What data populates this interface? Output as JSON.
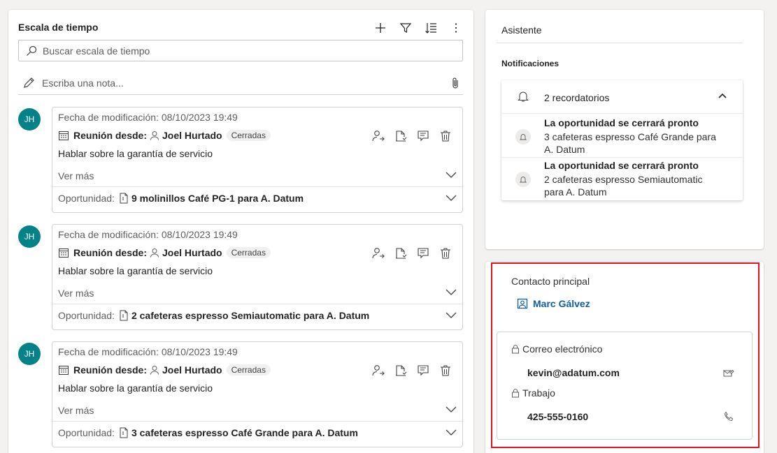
{
  "timeline": {
    "title": "Escala de tiempo",
    "search_placeholder": "Buscar escala de tiempo",
    "note_placeholder": "Escriba una nota...",
    "actions": [
      "add-icon",
      "filter-icon",
      "sort-icon",
      "more-icon"
    ],
    "items": [
      {
        "initials": "JH",
        "modified": "Fecha de modificación: 08/10/2023 19:49",
        "type_label": "Reunión desde:",
        "person": "Joel Hurtado",
        "status": "Cerradas",
        "subject": "Hablar sobre la garantía de servicio",
        "see_more": "Ver más",
        "opp_label": "Oportunidad:",
        "opp_name": "9 molinillos Café PG-1 para A. Datum"
      },
      {
        "initials": "JH",
        "modified": "Fecha de modificación: 08/10/2023 19:49",
        "type_label": "Reunión desde:",
        "person": "Joel Hurtado",
        "status": "Cerradas",
        "subject": "Hablar sobre la garantía de servicio",
        "see_more": "Ver más",
        "opp_label": "Oportunidad:",
        "opp_name": "2 cafeteras espresso Semiautomatic para A. Datum"
      },
      {
        "initials": "JH",
        "modified": "Fecha de modificación: 08/10/2023 19:49",
        "type_label": "Reunión desde:",
        "person": "Joel Hurtado",
        "status": "Cerradas",
        "subject": "Hablar sobre la garantía de servicio",
        "see_more": "Ver más",
        "opp_label": "Oportunidad:",
        "opp_name": "3 cafeteras espresso Café Grande para A. Datum"
      }
    ]
  },
  "assistant": {
    "title": "Asistente",
    "notifications_heading": "Notificaciones",
    "reminders_count": "2 recordatorios",
    "reminders": [
      {
        "title": "La oportunidad se cerrará pronto",
        "detail": "3 cafeteras espresso Café Grande para A. Datum"
      },
      {
        "title": "La oportunidad se cerrará pronto",
        "detail": "2 cafeteras espresso Semiautomatic para A. Datum"
      }
    ]
  },
  "contact": {
    "label": "Contacto principal",
    "name": "Marc Gálvez",
    "email_label": "Correo electrónico",
    "email": "kevin@adatum.com",
    "phone_label": "Trabajo",
    "phone": "425-555-0160"
  },
  "colors": {
    "avatar": "#038387",
    "link": "#115ea3",
    "highlight": "#e81123"
  }
}
